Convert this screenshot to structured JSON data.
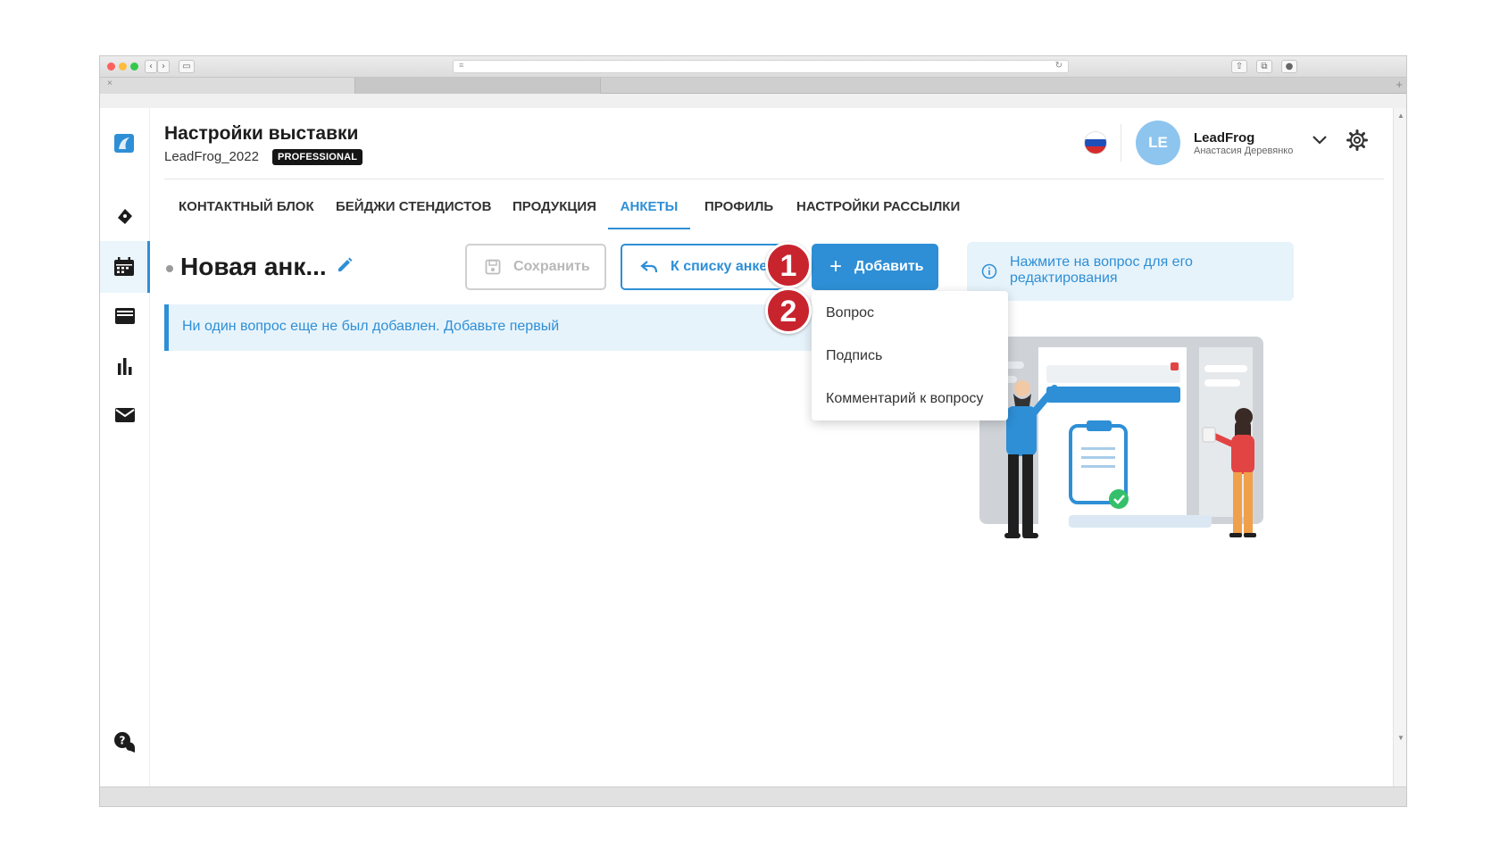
{
  "app": {
    "title": "Настройки выставки",
    "project": "LeadFrog_2022",
    "plan": "PROFESSIONAL"
  },
  "user": {
    "initials": "LE",
    "company": "LeadFrog",
    "name": "Анастасия Деревянко"
  },
  "tabs": [
    {
      "label": "КОНТАКТНЫЙ БЛОК",
      "active": false
    },
    {
      "label": "БЕЙДЖИ СТЕНДИСТОВ",
      "active": false
    },
    {
      "label": "ПРОДУКЦИЯ",
      "active": false
    },
    {
      "label": "АНКЕТЫ",
      "active": true
    },
    {
      "label": "ПРОФИЛЬ",
      "active": false
    },
    {
      "label": "НАСТРОЙКИ РАССЫЛКИ",
      "active": false
    }
  ],
  "form": {
    "title": "Новая анк..."
  },
  "toolbar": {
    "save_label": "Сохранить",
    "back_label": "К списку анкет",
    "add_label": "Добавить"
  },
  "hint": {
    "text": "Нажмите на вопрос для его редактирования"
  },
  "notice": {
    "text": "Ни один вопрос еще не был добавлен. Добавьте первый"
  },
  "dropdown": {
    "items": [
      "Вопрос",
      "Подпись",
      "Комментарий к вопросу"
    ]
  },
  "markers": [
    "1",
    "2"
  ],
  "sidebar": {
    "icons": [
      "logo-icon",
      "ticket-icon",
      "calendar-icon",
      "inbox-icon",
      "bar-chart-icon",
      "mail-icon",
      "help-chat-icon"
    ],
    "active": "calendar-icon"
  },
  "colors": {
    "accent": "#2e8fd6",
    "hint_bg": "#e7f3fb",
    "marker": "#c8242e",
    "avatar": "#8ec5ee"
  }
}
